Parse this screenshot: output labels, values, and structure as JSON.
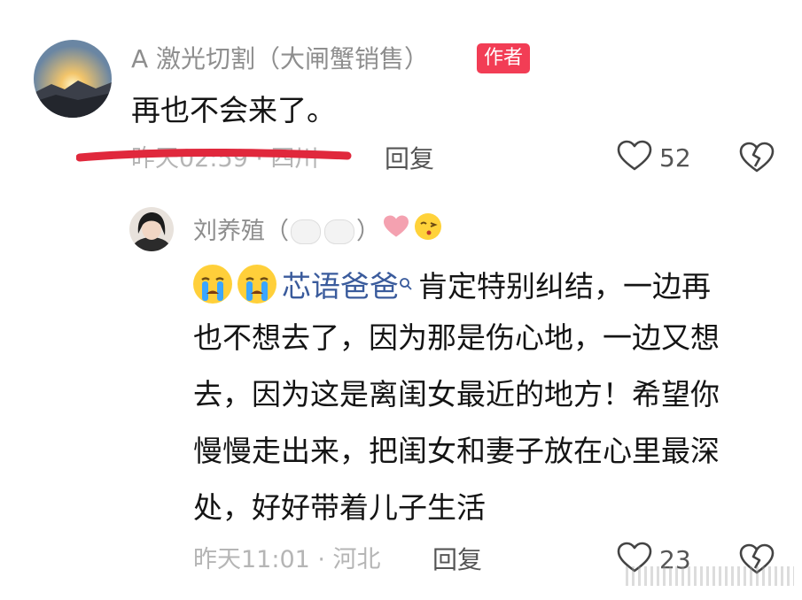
{
  "comment": {
    "username": "A 激光切割（大闸蟹销售）",
    "author_badge": "作者",
    "text": "再也不会来了。",
    "meta": "昨天02:59 · 四川",
    "reply_label": "回复",
    "like_count": "52"
  },
  "reply": {
    "username": "刘养殖（",
    "username_suffix": "）",
    "mention": "芯语爸爸",
    "text_first": "肯定特别纠结，一边再",
    "lines": [
      "也不想去了，因为那是伤心地，一边又想",
      "去，因为这是离闺女最近的地方！希望你",
      "慢慢走出来，把闺女和妻子放在心里最深",
      "处，好好带着儿子生活"
    ],
    "meta": "昨天11:01 · 河北",
    "reply_label": "回复",
    "like_count": "23"
  },
  "colors": {
    "badge": "#f23d55",
    "mention": "#3a5b9c",
    "strike": "#e0283c"
  }
}
